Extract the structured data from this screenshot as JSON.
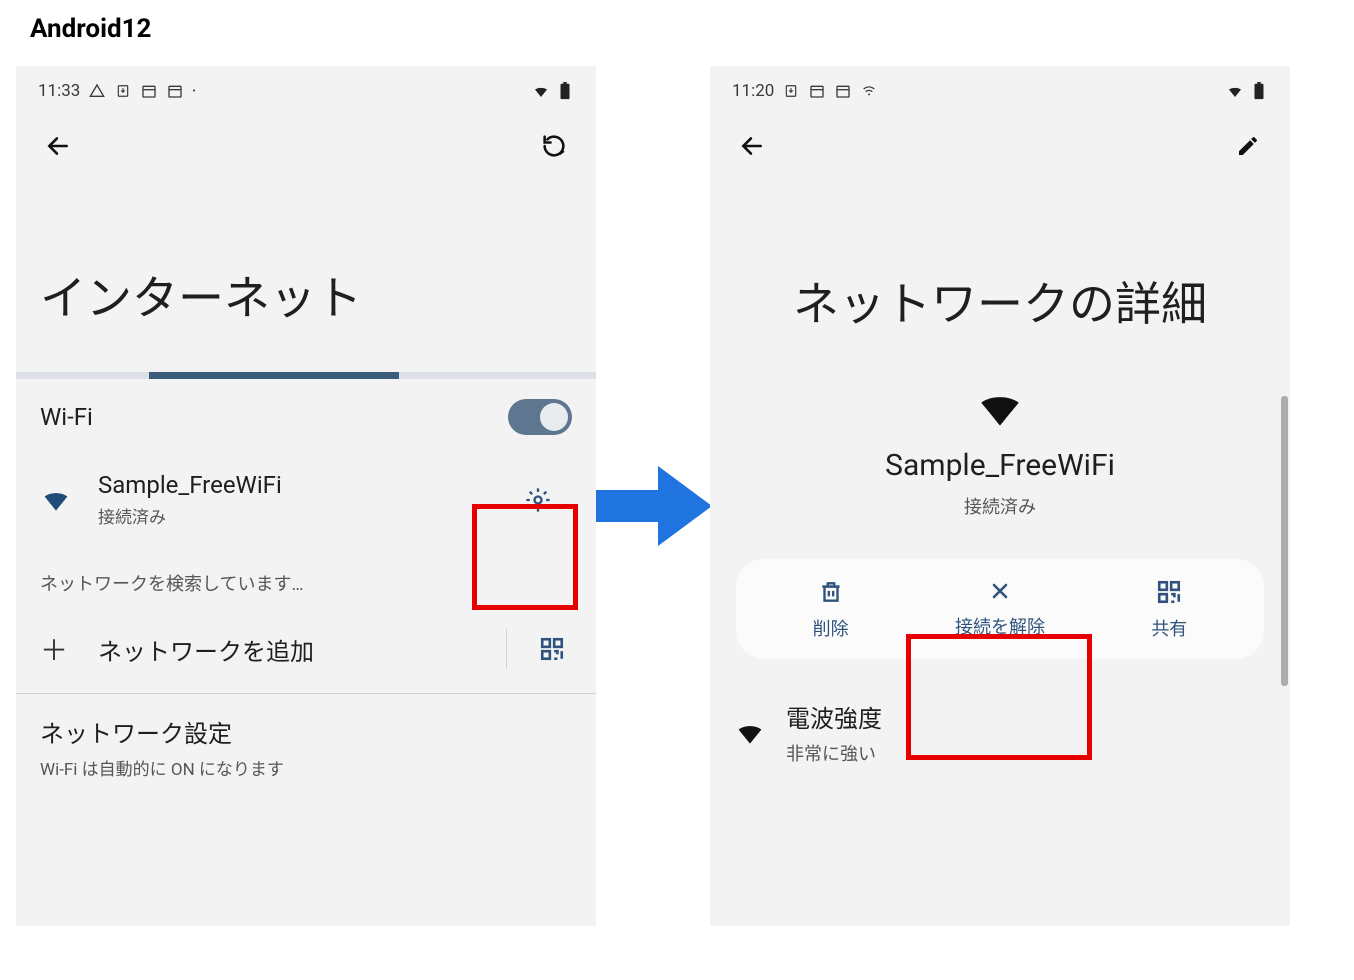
{
  "page_label": "Android12",
  "left": {
    "status": {
      "time": "11:33"
    },
    "title": "インターネット",
    "progress_left_pct": 23,
    "progress_width_pct": 43,
    "wifi_label": "Wi-Fi",
    "network": {
      "ssid": "Sample_FreeWiFi",
      "status": "接続済み"
    },
    "searching": "ネットワークを検索しています…",
    "add_network": "ネットワークを追加",
    "settings": {
      "title": "ネットワーク設定",
      "subtitle": "Wi-Fi は自動的に ON になります"
    }
  },
  "right": {
    "status": {
      "time": "11:20"
    },
    "title": "ネットワークの詳細",
    "network": {
      "ssid": "Sample_FreeWiFi",
      "status": "接続済み"
    },
    "actions": {
      "delete": "削除",
      "disconnect": "接続を解除",
      "share": "共有"
    },
    "signal": {
      "label": "電波強度",
      "value": "非常に強い"
    }
  },
  "colors": {
    "accent": "#2f537c",
    "wifi_blue": "#1f4b79"
  }
}
